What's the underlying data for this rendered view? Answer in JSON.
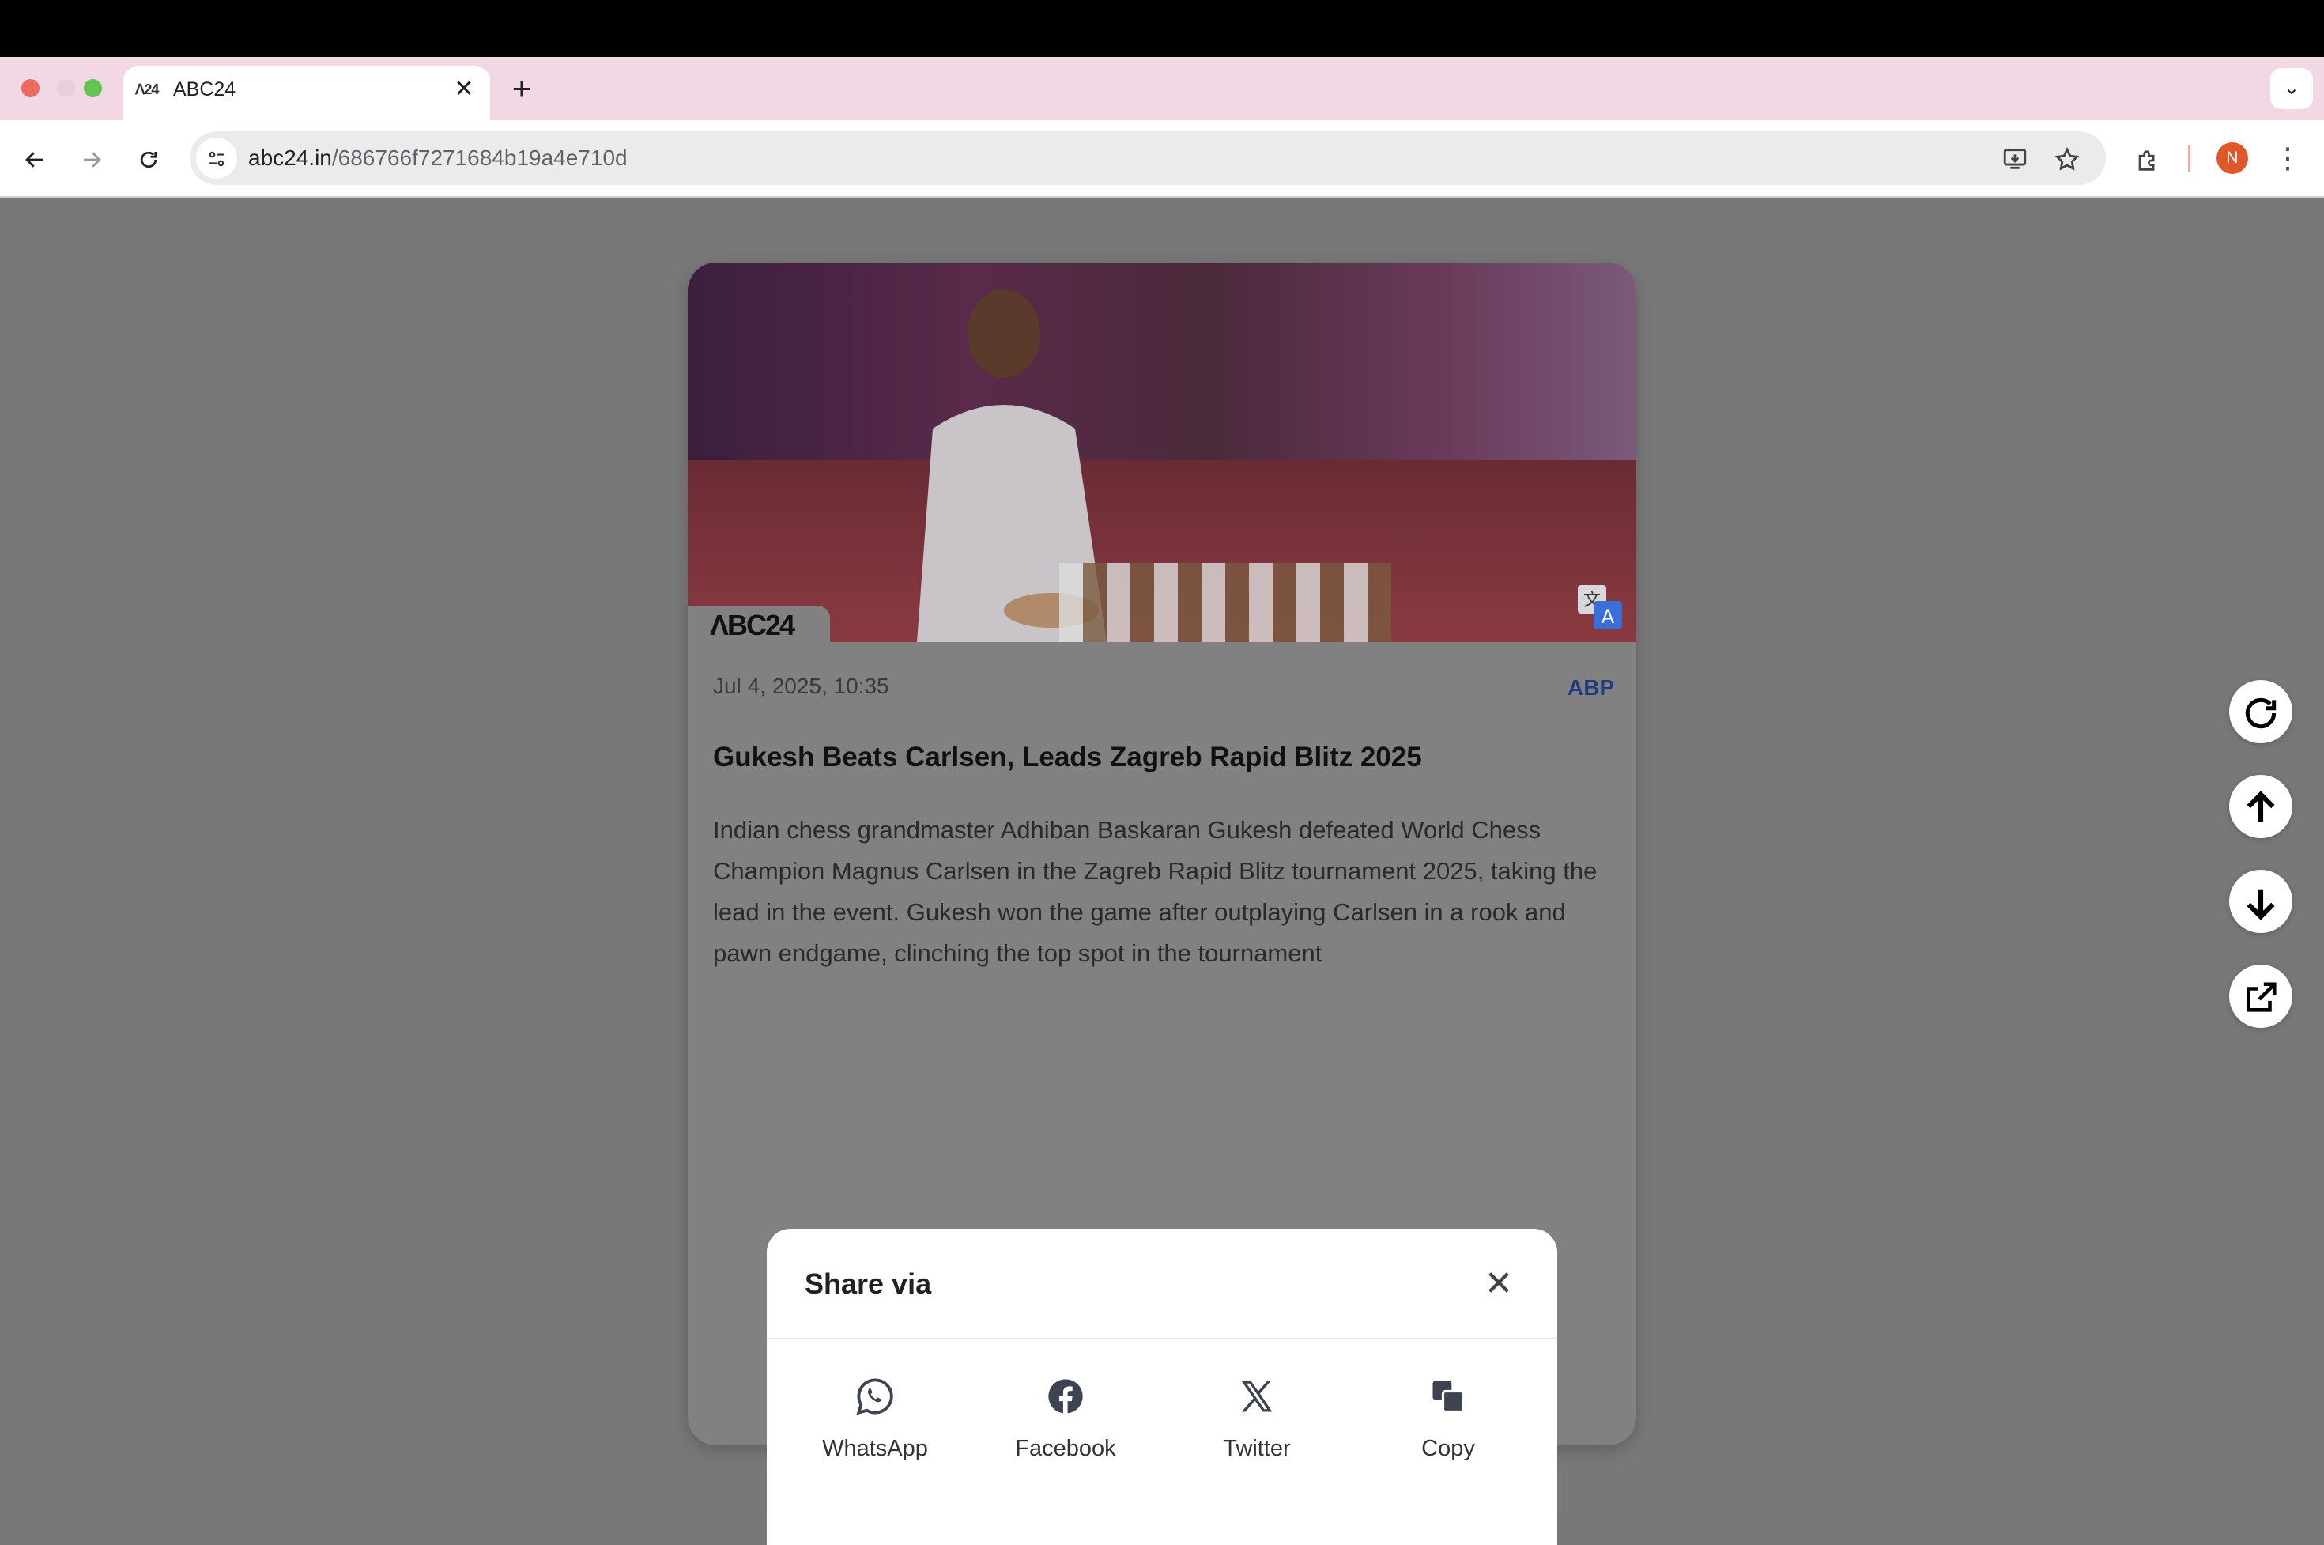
{
  "browser": {
    "tab": {
      "title": "ABC24",
      "favicon_text": "ᐱ24",
      "close_glyph": "✕"
    },
    "new_tab_glyph": "+",
    "tab_search_glyph": "⌄",
    "url_host": "abc24.in",
    "url_path": "/686766f7271684b19a4e710d",
    "avatar_initial": "N",
    "menu_glyph": "⋮"
  },
  "article": {
    "logo_text": "ΛBC24",
    "date": "Jul 4, 2025, 10:35",
    "source": "ABP",
    "headline": "Gukesh Beats Carlsen, Leads Zagreb Rapid Blitz 2025",
    "summary": "Indian chess grandmaster Adhiban Baskaran Gukesh defeated World Chess Champion Magnus Carlsen in the Zagreb Rapid Blitz tournament 2025, taking the lead in the event. Gukesh won the game after outplaying Carlsen in a rook and pawn endgame, clinching the top spot in the tournament"
  },
  "side_actions": [
    {
      "icon": "refresh-icon",
      "glyph": "↻"
    },
    {
      "icon": "arrow-up-icon",
      "glyph": "↑"
    },
    {
      "icon": "arrow-down-icon",
      "glyph": "↓"
    },
    {
      "icon": "external-link-icon",
      "glyph": "⧉"
    }
  ],
  "share": {
    "title": "Share via",
    "close_glyph": "✕",
    "options": [
      {
        "label": "WhatsApp",
        "icon": "whatsapp-icon"
      },
      {
        "label": "Facebook",
        "icon": "facebook-icon"
      },
      {
        "label": "Twitter",
        "icon": "x-twitter-icon"
      },
      {
        "label": "Copy",
        "icon": "copy-icon"
      }
    ]
  }
}
